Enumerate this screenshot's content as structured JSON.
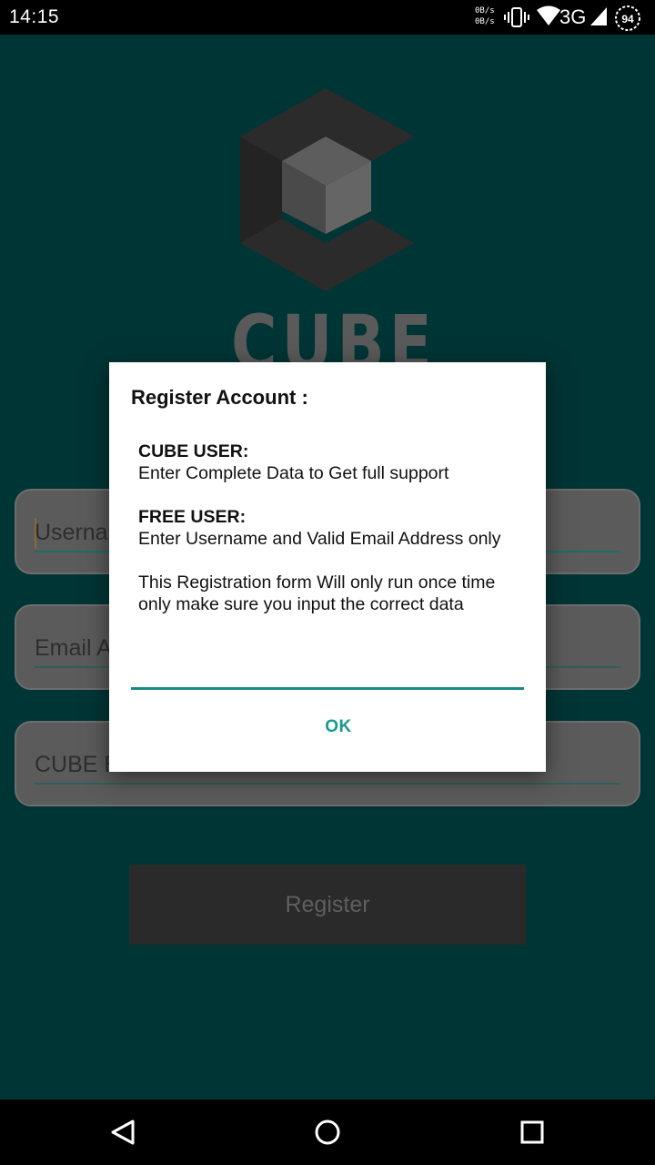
{
  "status_bar": {
    "time": "14:15",
    "net_up": "0B/s",
    "net_down": "0B/s",
    "network": "3G",
    "battery": "94",
    "icons": [
      "vibrate-icon",
      "wifi-icon",
      "signal-icon",
      "battery-icon"
    ]
  },
  "app": {
    "logo_text": "CUBE",
    "fields": {
      "username_placeholder": "Userna",
      "email_placeholder": "Email A",
      "cube_id_placeholder": "CUBE B"
    },
    "register_label": "Register"
  },
  "dialog": {
    "title": "Register Account :",
    "cube_user_heading": "CUBE USER:",
    "cube_user_text": "Enter Complete Data to Get full support",
    "free_user_heading": "FREE USER:",
    "free_user_text": "Enter Username and Valid Email Address only",
    "note": "This Registration form Will only run once time only make sure you input the correct data",
    "ok_label": "OK",
    "accent_color": "#159a90"
  },
  "nav_bar": {
    "icons": [
      "back-icon",
      "home-icon",
      "recents-icon"
    ]
  }
}
